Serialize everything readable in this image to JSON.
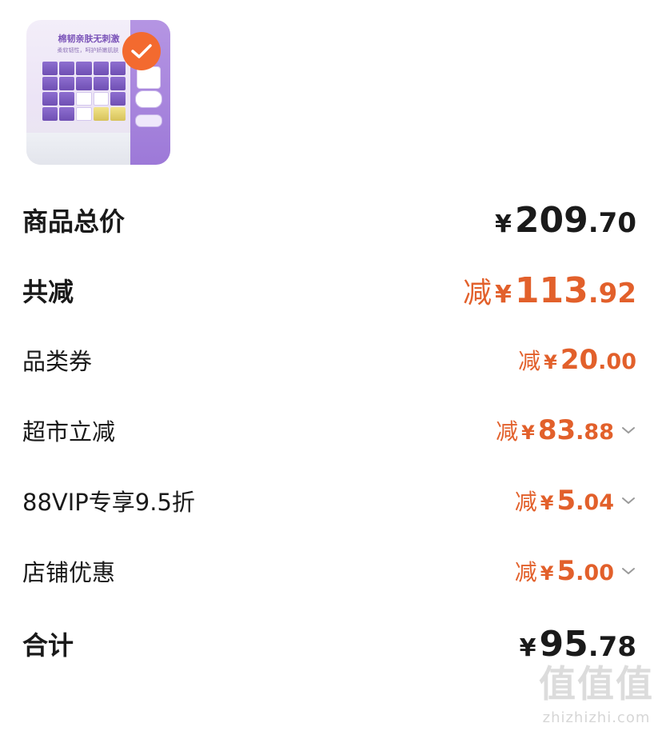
{
  "product": {
    "headline": "棉韧亲肤无刺激",
    "subline": "柔软韧性，呵护娇嫩肌肤",
    "selected": true
  },
  "rows": [
    {
      "label": "商品总价",
      "prefix": "",
      "yen": "¥",
      "int": "209",
      "dec": ".70",
      "tone": "black",
      "emphasis": true,
      "chevron": false
    },
    {
      "label": "共减",
      "prefix": "减",
      "yen": "¥",
      "int": "113",
      "dec": ".92",
      "tone": "orange",
      "emphasis": true,
      "chevron": false
    },
    {
      "label": "品类券",
      "prefix": "减",
      "yen": "¥",
      "int": "20",
      "dec": ".00",
      "tone": "orange",
      "emphasis": false,
      "chevron": false
    },
    {
      "label": "超市立减",
      "prefix": "减",
      "yen": "¥",
      "int": "83",
      "dec": ".88",
      "tone": "orange",
      "emphasis": false,
      "chevron": true
    },
    {
      "label": "88VIP专享9.5折",
      "prefix": "减",
      "yen": "¥",
      "int": "5",
      "dec": ".04",
      "tone": "orange",
      "emphasis": false,
      "chevron": true
    },
    {
      "label": "店铺优惠",
      "prefix": "减",
      "yen": "¥",
      "int": "5",
      "dec": ".00",
      "tone": "orange",
      "emphasis": false,
      "chevron": true
    },
    {
      "label": "合计",
      "prefix": "",
      "yen": "¥",
      "int": "95",
      "dec": ".78",
      "tone": "black",
      "emphasis": true,
      "chevron": false
    }
  ],
  "watermark": {
    "big": "值",
    "small": "zhizhizhi.com"
  },
  "colors": {
    "accent": "#e2602b",
    "text": "#1a1a1a",
    "check": "#f36a2f"
  }
}
